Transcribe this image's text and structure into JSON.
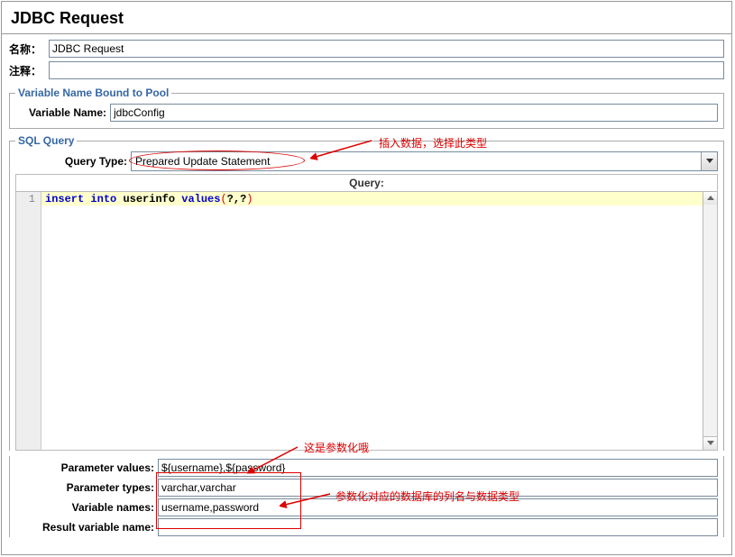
{
  "title": "JDBC Request",
  "fields": {
    "name_label": "名称：",
    "name_value": "JDBC Request",
    "comment_label": "注释：",
    "comment_value": ""
  },
  "pool": {
    "legend": "Variable Name Bound to Pool",
    "var_label": "Variable Name:",
    "var_value": "jdbcConfig"
  },
  "sql": {
    "legend": "SQL Query",
    "qtype_label": "Query Type:",
    "qtype_value": "Prepared Update Statement",
    "query_header": "Query:",
    "line_no": "1",
    "code": {
      "kw_insert": "insert",
      "kw_into": "into",
      "ident": "userinfo",
      "kw_values": "values",
      "p_open": "(",
      "p_q1": "?,?",
      "p_close": ")"
    }
  },
  "params": {
    "pv_label": "Parameter values:",
    "pv_value": "${username},${password}",
    "pt_label": "Parameter types:",
    "pt_value": "varchar,varchar",
    "vn_label": "Variable names:",
    "vn_value": "username,password",
    "rvn_label": "Result variable name:",
    "rvn_value": ""
  },
  "annotations": {
    "a1": "插入数据，选择此类型",
    "a2": "这是参数化哦",
    "a3": "参数化对应的数据库的列名与数据类型"
  }
}
